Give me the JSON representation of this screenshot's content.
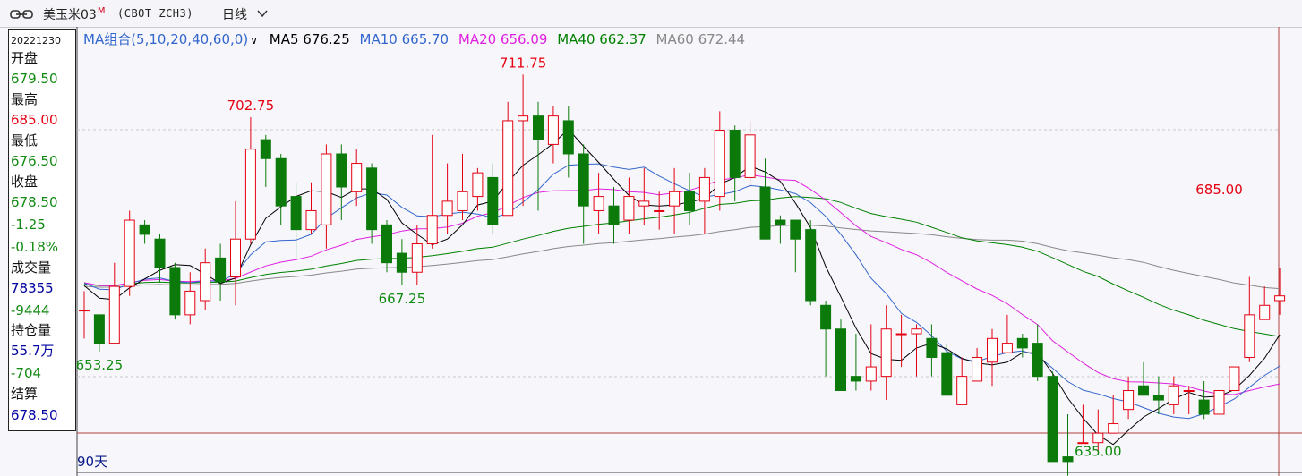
{
  "title": {
    "name": "美玉米03",
    "badge": "M",
    "code": "(CBOT ZCH3)",
    "period": "日线"
  },
  "info": {
    "date": "20221230",
    "open_label": "开盘",
    "open": "679.50",
    "high_label": "最高",
    "high": "685.00",
    "low_label": "最低",
    "low": "676.50",
    "close_label": "收盘",
    "close": "678.50",
    "change": "-1.25",
    "change_pct": "-0.18%",
    "volume_label": "成交量",
    "volume": "78355",
    "volume_change": "-9444",
    "oi_label": "持仓量",
    "oi": "55.7万",
    "oi_change": "-704",
    "settle_label": "结算",
    "settle": "678.50"
  },
  "legend": {
    "group": "MA组合(5,10,20,40,60,0)",
    "ma5": "MA5 676.25",
    "ma10": "MA10 665.70",
    "ma20": "MA20 656.09",
    "ma40": "MA40 662.37",
    "ma60": "MA60 672.44"
  },
  "days_label": "90天",
  "colors": {
    "up": "#e60012",
    "down": "#0b7a0b",
    "ma5": "#000000",
    "ma10": "#3366cc",
    "ma20": "#e020e0",
    "ma40": "#008000",
    "ma60": "#888888"
  },
  "chart_data": {
    "type": "candlestick",
    "title": "美玉米03 (CBOT ZCH3) 日线",
    "ylim": [
      633,
      719
    ],
    "annotations": [
      {
        "index": 1,
        "value": 653.25,
        "label": "653.25"
      },
      {
        "index": 11,
        "value": 702.75,
        "label": "702.75"
      },
      {
        "index": 21,
        "value": 667.25,
        "label": "667.25"
      },
      {
        "index": 29,
        "value": 711.75,
        "label": "711.75"
      },
      {
        "index": 67,
        "value": 635.0,
        "label": "635.00"
      },
      {
        "index": 75,
        "value": 685.0,
        "label": "685.00"
      }
    ],
    "candles": [
      [
        662,
        662,
        666,
        656
      ],
      [
        661,
        655,
        661,
        653.25
      ],
      [
        655,
        667,
        672,
        655
      ],
      [
        667,
        681,
        683,
        665
      ],
      [
        680,
        678,
        681,
        676
      ],
      [
        677,
        671,
        678,
        668
      ],
      [
        671,
        661,
        672,
        660
      ],
      [
        661,
        666,
        670,
        659
      ],
      [
        664,
        672,
        675,
        662
      ],
      [
        673,
        668,
        676,
        664
      ],
      [
        669,
        677,
        685,
        663
      ],
      [
        677,
        696,
        702.75,
        676
      ],
      [
        698,
        694,
        699,
        688
      ],
      [
        694,
        684,
        695,
        680
      ],
      [
        686,
        679,
        689,
        673
      ],
      [
        679,
        683,
        689,
        678
      ],
      [
        680,
        695,
        697,
        675
      ],
      [
        695,
        688,
        697,
        681
      ],
      [
        687,
        693,
        696,
        684
      ],
      [
        692,
        679,
        693,
        676
      ],
      [
        680,
        672,
        681,
        670
      ],
      [
        674,
        670,
        677,
        667.25
      ],
      [
        670,
        676,
        680,
        667.25
      ],
      [
        676,
        682,
        699,
        675
      ],
      [
        682,
        685,
        693,
        678
      ],
      [
        683,
        687,
        695,
        681
      ],
      [
        686,
        691,
        692,
        683
      ],
      [
        690,
        680,
        693,
        678
      ],
      [
        682,
        702,
        706,
        682
      ],
      [
        702,
        703,
        711.75,
        684
      ],
      [
        703,
        698,
        706,
        683
      ],
      [
        697,
        703,
        705,
        693
      ],
      [
        702,
        695,
        705,
        690
      ],
      [
        695,
        684,
        697,
        676
      ],
      [
        683,
        686,
        691,
        678
      ],
      [
        684,
        680,
        688,
        676
      ],
      [
        681,
        686,
        690,
        678
      ],
      [
        684,
        685,
        692,
        680
      ],
      [
        683,
        683,
        687,
        679
      ],
      [
        684,
        687,
        692,
        678
      ],
      [
        687,
        683,
        691,
        680
      ],
      [
        685,
        690,
        692,
        678
      ],
      [
        686,
        700,
        704,
        683
      ],
      [
        700,
        690,
        701,
        685
      ],
      [
        690,
        699,
        702,
        688
      ],
      [
        688,
        677,
        694,
        677
      ],
      [
        681,
        680,
        682,
        676
      ],
      [
        681,
        677,
        681,
        670
      ],
      [
        679,
        664,
        681,
        663
      ],
      [
        663,
        658,
        664,
        648
      ],
      [
        658,
        645,
        660,
        645
      ],
      [
        648,
        647,
        657,
        645
      ],
      [
        647,
        650,
        659,
        645
      ],
      [
        648,
        658,
        663,
        643
      ],
      [
        657,
        657,
        661,
        650
      ],
      [
        657,
        658,
        659,
        648
      ],
      [
        656,
        652,
        659,
        648
      ],
      [
        653,
        644,
        655,
        644
      ],
      [
        642,
        648,
        652,
        646
      ],
      [
        647,
        652,
        654,
        647
      ],
      [
        651,
        656,
        658,
        646
      ],
      [
        653,
        655,
        661,
        654
      ],
      [
        656,
        654,
        657,
        652
      ],
      [
        655,
        648,
        659,
        647
      ],
      [
        648,
        630,
        649,
        630
      ],
      [
        631,
        630,
        640,
        627
      ],
      [
        634,
        634,
        642,
        634
      ],
      [
        634,
        636,
        641,
        632
      ],
      [
        636,
        638,
        644,
        637
      ],
      [
        641,
        645,
        648,
        639
      ],
      [
        646,
        644,
        651,
        644
      ],
      [
        644,
        643,
        648,
        640
      ],
      [
        642,
        646,
        648,
        640
      ],
      [
        645,
        645,
        646,
        640
      ],
      [
        643,
        640,
        647,
        639
      ],
      [
        640,
        645,
        645,
        641
      ],
      [
        645,
        650,
        650,
        646
      ],
      [
        652,
        661,
        669,
        651
      ],
      [
        660,
        663,
        667,
        660
      ],
      [
        664,
        665,
        671,
        661
      ]
    ]
  }
}
